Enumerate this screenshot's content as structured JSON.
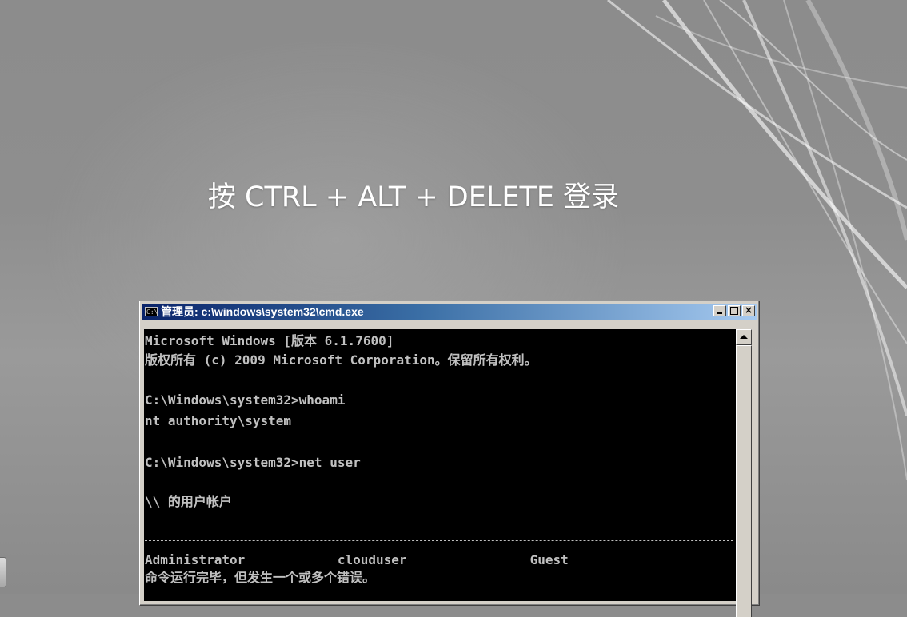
{
  "login_prompt": "按 CTRL + ALT + DELETE 登录",
  "cmd_window": {
    "icon_text": "C:\\",
    "title": "管理员: c:\\windows\\system32\\cmd.exe",
    "buttons": {
      "minimize": "",
      "maximize": "",
      "close": "×"
    },
    "lines": [
      "Microsoft Windows [版本 6.1.7600]",
      "版权所有 (c) 2009 Microsoft Corporation。保留所有权利。",
      "",
      "C:\\Windows\\system32>whoami",
      "nt authority\\system",
      "",
      "C:\\Windows\\system32>net user",
      "",
      "\\\\ 的用户帐户",
      "",
      "",
      "Administrator            clouduser                Guest",
      "命令运行完毕，但发生一个或多个错误。"
    ]
  }
}
